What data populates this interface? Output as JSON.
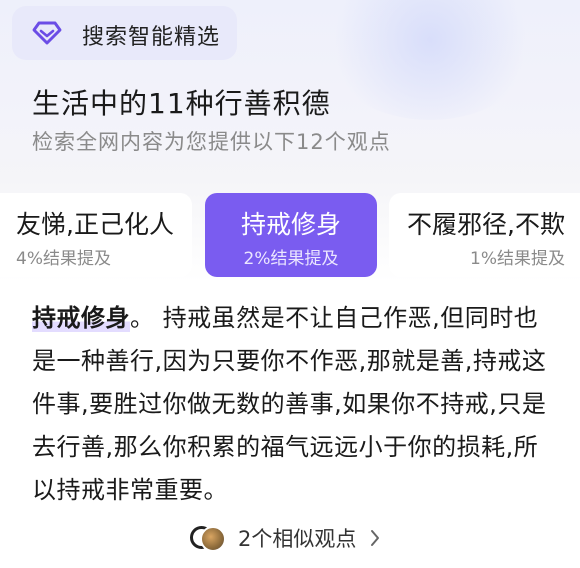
{
  "header": {
    "title": "搜索智能精选",
    "icon": "diamond-icon",
    "accent": "#6b4de6"
  },
  "summary": {
    "title": "生活中的11种行善积德",
    "subtitle": "检索全网内容为您提供以下12个观点"
  },
  "tabs": [
    {
      "label": "友悌,正己化人",
      "sub": "4%结果提及",
      "active": false
    },
    {
      "label": "持戒修身",
      "sub": "2%结果提及",
      "active": true
    },
    {
      "label": "不履邪径,不欺",
      "sub": "1%结果提及",
      "active": false
    }
  ],
  "content": {
    "highlight": "持戒修身",
    "separator": "。",
    "body": " 持戒虽然是不让自己作恶,但同时也是一种善行,因为只要你不作恶,那就是善,持戒这件事,要胜过你做无数的善事,如果你不持戒,只是去行善,那么你积累的福气远远小于你的损耗,所以持戒非常重要。"
  },
  "similar": {
    "label": "2个相似观点",
    "icon": "chevron-right-icon"
  },
  "colors": {
    "active_tab": "#7a5cf0",
    "highlight_bg": "#e3dcff"
  }
}
